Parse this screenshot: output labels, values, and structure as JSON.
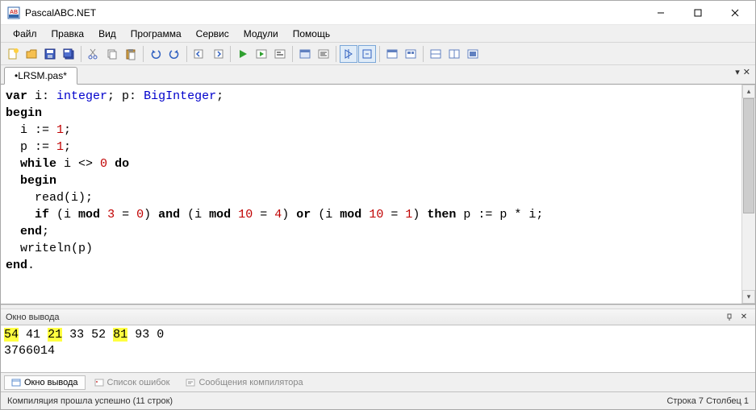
{
  "title": "PascalABC.NET",
  "menu": [
    "Файл",
    "Правка",
    "Вид",
    "Программа",
    "Сервис",
    "Модули",
    "Помощь"
  ],
  "tab": {
    "label": "•LRSM.pas*"
  },
  "code": {
    "l1_var": "var",
    "l1_i": " i: ",
    "l1_integer": "integer",
    "l1_sep": "; p: ",
    "l1_bigint": "BigInteger",
    "l1_end": ";",
    "l2": "begin",
    "l3a": "  i := ",
    "l3n": "1",
    "l3b": ";",
    "l4a": "  p := ",
    "l4n": "1",
    "l4b": ";",
    "l5a": "  ",
    "l5w": "while",
    "l5b": " i <> ",
    "l5n": "0",
    "l5c": " ",
    "l5d": "do",
    "l6a": "  ",
    "l6b": "begin",
    "l7": "    read(i);",
    "l8a": "    ",
    "l8if": "if",
    "l8b": " (i ",
    "l8mod1": "mod",
    "l8c": " ",
    "l8n3": "3",
    "l8d": " = ",
    "l8n0": "0",
    "l8e": ") ",
    "l8and": "and",
    "l8f": " (i ",
    "l8mod2": "mod",
    "l8g": " ",
    "l8n10a": "10",
    "l8h": " = ",
    "l8n4": "4",
    "l8i": ") ",
    "l8or": "or",
    "l8j": " (i ",
    "l8mod3": "mod",
    "l8k": " ",
    "l8n10b": "10",
    "l8l": " = ",
    "l8n1": "1",
    "l8m": ") ",
    "l8then": "then",
    "l8n": " p := p * i;",
    "l9a": "  ",
    "l9e": "end",
    "l9b": ";",
    "l10": "  writeln(p)",
    "l11": "end",
    "l11b": "."
  },
  "output_panel": {
    "title": "Окно вывода",
    "line1_tokens": [
      {
        "t": "54",
        "hl": true
      },
      {
        "t": " "
      },
      {
        "t": "41"
      },
      {
        "t": " "
      },
      {
        "t": "21",
        "hl": true
      },
      {
        "t": " "
      },
      {
        "t": "33"
      },
      {
        "t": " "
      },
      {
        "t": "52"
      },
      {
        "t": " "
      },
      {
        "t": "81",
        "hl": true
      },
      {
        "t": " "
      },
      {
        "t": "93"
      },
      {
        "t": " "
      },
      {
        "t": "0"
      }
    ],
    "line2": "3766014"
  },
  "bottom_tabs": {
    "t1": "Окно вывода",
    "t2": "Список ошибок",
    "t3": "Сообщения компилятора"
  },
  "status": {
    "left": "Компиляция прошла успешно (11 строк)",
    "right": "Строка  7  Столбец  1"
  }
}
